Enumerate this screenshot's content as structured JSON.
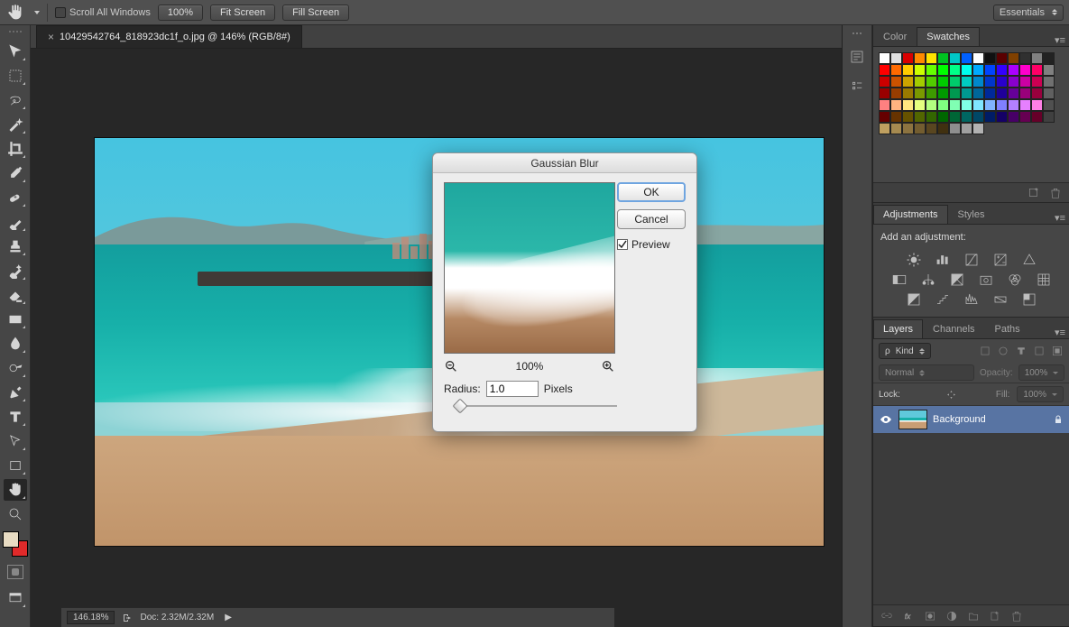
{
  "options": {
    "scroll_all": "Scroll All Windows",
    "zoom": "100%",
    "fit": "Fit Screen",
    "fill": "Fill Screen",
    "workspace": "Essentials"
  },
  "document": {
    "tab_title": "10429542764_818923dc1f_o.jpg @ 146% (RGB/8#)"
  },
  "dialog": {
    "title": "Gaussian Blur",
    "ok": "OK",
    "cancel": "Cancel",
    "preview": "Preview",
    "preview_checked": true,
    "zoom": "100%",
    "radius_label": "Radius:",
    "radius_value": "1.0",
    "unit": "Pixels"
  },
  "panels": {
    "color": "Color",
    "swatches": "Swatches",
    "swatch_colors": [
      "#ffffff",
      "#e0e0e0",
      "#d90000",
      "#ff8a00",
      "#ffe300",
      "#00c221",
      "#00c6c6",
      "#0060ff",
      "#ffffff",
      "#101010",
      "#5a0000",
      "#804000",
      "#303030",
      "#808080",
      "#222222",
      "#ff0000",
      "#ff6a00",
      "#ffcc00",
      "#ccff00",
      "#66ff00",
      "#00ff00",
      "#00ff88",
      "#00ffee",
      "#00aaff",
      "#0044ff",
      "#3300ff",
      "#aa00ff",
      "#ff00cc",
      "#ff0066",
      "#808080",
      "#cc0000",
      "#cc5200",
      "#cca300",
      "#a3cc00",
      "#52cc00",
      "#00cc00",
      "#00cc6b",
      "#00ccc0",
      "#0088cc",
      "#0036cc",
      "#2900cc",
      "#8800cc",
      "#cc00a3",
      "#cc0052",
      "#707070",
      "#990000",
      "#993d00",
      "#997a00",
      "#7a9900",
      "#3d9900",
      "#009900",
      "#009950",
      "#009991",
      "#006699",
      "#002999",
      "#1f0099",
      "#660099",
      "#99007a",
      "#99003d",
      "#606060",
      "#ff8080",
      "#ffb380",
      "#ffe680",
      "#e6ff80",
      "#b3ff80",
      "#80ff80",
      "#80ffb3",
      "#80ffe6",
      "#80e6ff",
      "#80b3ff",
      "#8080ff",
      "#b380ff",
      "#e680ff",
      "#ff80e6",
      "#505050",
      "#660000",
      "#663300",
      "#665200",
      "#526600",
      "#336600",
      "#006600",
      "#006636",
      "#006661",
      "#004766",
      "#001c66",
      "#150066",
      "#470066",
      "#660052",
      "#660029",
      "#404040",
      "#bfa060",
      "#a68a50",
      "#8c7340",
      "#735d30",
      "#594620",
      "#403010",
      "#8e8e8e",
      "#a0a0a0",
      "#b2b2b2"
    ],
    "adjustments": "Adjustments",
    "styles": "Styles",
    "adj_label": "Add an adjustment:",
    "layers": "Layers",
    "channels": "Channels",
    "paths": "Paths",
    "kind": "Kind",
    "blend": "Normal",
    "opacity_label": "Opacity:",
    "opacity_val": "100%",
    "lock": "Lock:",
    "fill_label": "Fill:",
    "fill_val": "100%",
    "layer_name": "Background"
  },
  "status": {
    "zoom": "146.18%",
    "doc": "Doc: 2.32M/2.32M"
  }
}
